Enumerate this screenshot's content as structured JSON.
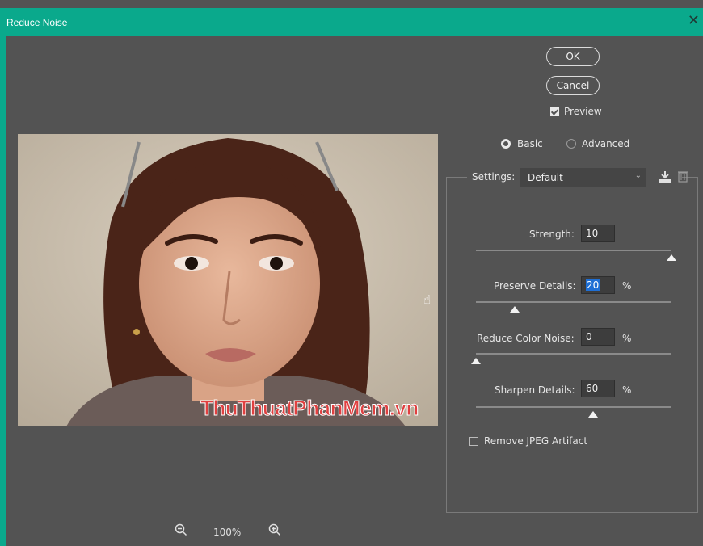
{
  "window": {
    "title": "Reduce Noise",
    "close_glyph": "✕"
  },
  "buttons": {
    "ok": "OK",
    "cancel": "Cancel"
  },
  "preview_checkbox": {
    "label": "Preview",
    "checked": true
  },
  "mode": {
    "basic": "Basic",
    "advanced": "Advanced",
    "selected": "Basic"
  },
  "settings": {
    "label": "Settings:",
    "value": "Default",
    "save_icon": "save-preset-icon",
    "delete_icon": "trash-icon"
  },
  "controls": [
    {
      "label": "Strength:",
      "value": "10",
      "unit": "",
      "level": 1.0
    },
    {
      "label": "Preserve Details:",
      "value": "20",
      "unit": "%",
      "level": 0.2
    },
    {
      "label": "Reduce Color Noise:",
      "value": "0",
      "unit": "%",
      "level": 0.0
    },
    {
      "label": "Sharpen Details:",
      "value": "60",
      "unit": "%",
      "level": 0.6
    }
  ],
  "jpeg": {
    "label": "Remove JPEG Artifact",
    "checked": false
  },
  "zoom": {
    "level": "100%",
    "zoom_out_icon": "zoom-out-icon",
    "zoom_in_icon": "zoom-in-icon"
  },
  "watermark": "ThuThuatPhanMem.vn",
  "colors": {
    "titlebar": "#0aa98c",
    "background": "#535353",
    "selection": "#1f6fd4"
  }
}
